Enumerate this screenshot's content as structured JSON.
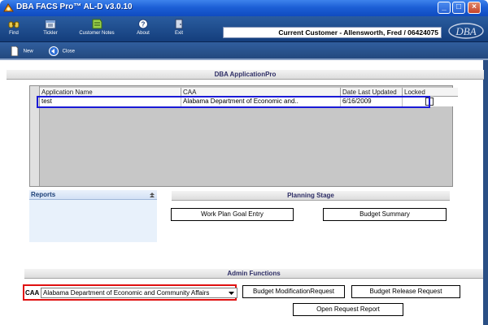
{
  "window": {
    "title": "DBA FACS Pro™ AL-D v3.0.10",
    "controls": {
      "minimize": "_",
      "maximize": "□",
      "close": "×"
    }
  },
  "toolbar": {
    "items": [
      {
        "label": "Find",
        "icon": "binoculars-icon"
      },
      {
        "label": "Tickler",
        "icon": "calendar-icon"
      },
      {
        "label": "Customer Notes",
        "icon": "notes-icon"
      },
      {
        "label": "About",
        "icon": "help-icon"
      },
      {
        "label": "Exit",
        "icon": "exit-door-icon"
      }
    ],
    "current_customer": "Current Customer - Allensworth, Fred / 06424075",
    "logo_text": "DBA"
  },
  "subtoolbar": {
    "new_label": "New",
    "close_label": "Close"
  },
  "application_section": {
    "title": "DBA ApplicationPro",
    "columns": [
      "Application Name",
      "CAA",
      "Date Last Updated",
      "Locked"
    ],
    "rows": [
      {
        "name": "test",
        "caa": "Alabama Department of Economic and..",
        "date": "6/16/2009",
        "locked": false
      }
    ]
  },
  "reports": {
    "title": "Reports"
  },
  "planning": {
    "title": "Planning Stage",
    "work_plan_label": "Work Plan Goal Entry",
    "budget_summary_label": "Budget Summary"
  },
  "admin": {
    "title": "Admin Functions",
    "caa_label": "CAA",
    "caa_value": "Alabama Department of Economic and Community Affairs",
    "budget_mod_label": "Budget ModificationRequest",
    "budget_release_label": "Budget Release Request",
    "open_request_label": "Open Request Report"
  },
  "colors": {
    "titlebar": "#1c5fd6",
    "toolbar": "#143e7c",
    "row_highlight": "#1a1ad6",
    "caa_highlight": "#e01010"
  }
}
